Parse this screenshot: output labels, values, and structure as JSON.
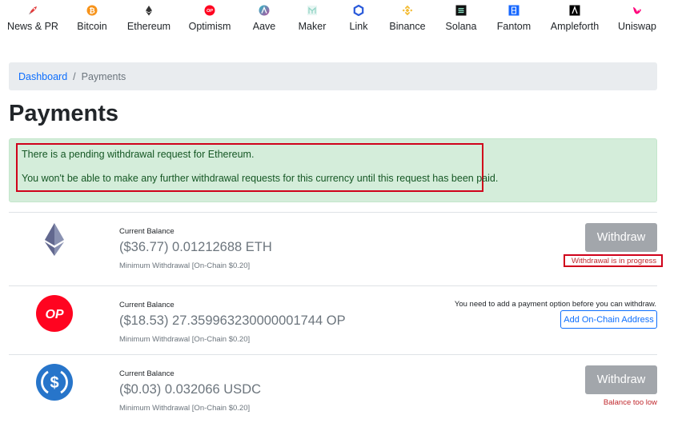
{
  "nav": {
    "items": [
      {
        "label": "News & PR",
        "icon": "rocket-icon"
      },
      {
        "label": "Bitcoin",
        "icon": "bitcoin-icon"
      },
      {
        "label": "Ethereum",
        "icon": "ethereum-icon"
      },
      {
        "label": "Optimism",
        "icon": "optimism-icon"
      },
      {
        "label": "Aave",
        "icon": "aave-icon"
      },
      {
        "label": "Maker",
        "icon": "maker-icon"
      },
      {
        "label": "Link",
        "icon": "chainlink-icon"
      },
      {
        "label": "Binance",
        "icon": "binance-icon"
      },
      {
        "label": "Solana",
        "icon": "solana-icon"
      },
      {
        "label": "Fantom",
        "icon": "fantom-icon"
      },
      {
        "label": "Ampleforth",
        "icon": "ampleforth-icon"
      },
      {
        "label": "Uniswap",
        "icon": "uniswap-icon"
      }
    ]
  },
  "breadcrumb": {
    "home": "Dashboard",
    "separator": "/",
    "current": "Payments"
  },
  "page": {
    "title": "Payments"
  },
  "alert": {
    "line1": "There is a pending withdrawal request for Ethereum.",
    "line2": "You won't be able to make any further withdrawal requests for this currency until this request has been paid."
  },
  "currencies": [
    {
      "icon": "ethereum-icon",
      "balance_label": "Current Balance",
      "amount": "($36.77) 0.01212688 ETH",
      "minimum": "Minimum Withdrawal [On-Chain $0.20]",
      "action_label": "Withdraw",
      "status": "Withdrawal is in progress"
    },
    {
      "icon": "optimism-icon",
      "icon_text": "OP",
      "balance_label": "Current Balance",
      "amount": "($18.53) 27.359963230000001744 OP",
      "minimum": "Minimum Withdrawal [On-Chain $0.20]",
      "notice": "You need to add a payment option before you can withdraw.",
      "action_label": "Add On-Chain Address"
    },
    {
      "icon": "usdc-icon",
      "balance_label": "Current Balance",
      "amount": "($0.03) 0.032066 USDC",
      "minimum": "Minimum Withdrawal [On-Chain $0.20]",
      "action_label": "Withdraw",
      "status": "Balance too low"
    }
  ],
  "colors": {
    "link": "#0d6efd",
    "alert_bg": "#d4edda",
    "alert_text": "#155724",
    "highlight_border": "#d0021b",
    "disabled_button": "#a2a6ab",
    "optimism_red": "#ff0420",
    "usdc_blue": "#2775ca"
  }
}
